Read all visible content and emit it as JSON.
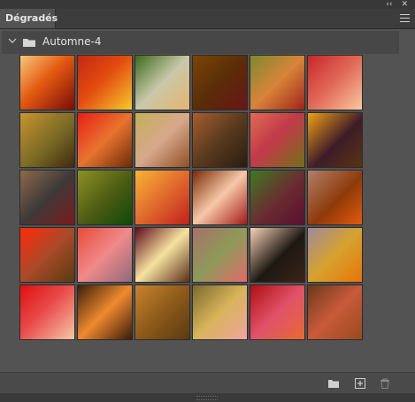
{
  "panel": {
    "tab_title": "Dégradés",
    "collapse_glyph": "‹‹",
    "close_glyph": "✕"
  },
  "group": {
    "name": "Automne-4",
    "expanded": true
  },
  "icons": {
    "chevron": "chevron-down-icon",
    "folder": "folder-icon",
    "new_group": "folder-icon",
    "new_gradient": "add-icon",
    "delete": "trash-icon",
    "menu": "panel-menu-icon"
  },
  "swatches": [
    "linear-gradient(135deg,#f5c87a 0%,#e45a12 45%,#7a0c06 100%)",
    "linear-gradient(135deg,#c22a12 0%,#e24a10 45%,#f7c92e 100%)",
    "linear-gradient(135deg,#3d6a1e 0%,#c9c8a8 50%,#e5b46e 100%)",
    "linear-gradient(135deg,#7a4606 0%,#5a2d08 50%,#6a1416 100%)",
    "linear-gradient(135deg,#7d8a2e 0%,#d8843a 50%,#a02418 100%)",
    "linear-gradient(135deg,#c8262a 0%,#e26a58 50%,#f8c9a0 100%)",
    "linear-gradient(135deg,#c8942e 0%,#7a6a26 55%,#3e2a0c 100%)",
    "linear-gradient(135deg,#e81e16 0%,#e8742e 50%,#6e2a08 100%)",
    "linear-gradient(135deg,#c2b058 0%,#d8a88c 50%,#8e5022 100%)",
    "linear-gradient(135deg,#a65e30 0%,#5a3a1e 50%,#2a1c10 100%)",
    "linear-gradient(135deg,#e26a52 0%,#c23a4a 45%,#747018 100%)",
    "linear-gradient(135deg,#f0a016 0%,#3e1c28 55%,#5a3412 100%)",
    "linear-gradient(135deg,#8e6a4a 0%,#3e3a3a 50%,#7a1c1a 100%)",
    "linear-gradient(135deg,#8e9026 0%,#4a5a12 55%,#0e4a08 100%)",
    "linear-gradient(135deg,#f8b436 0%,#e06a2e 50%,#c2201a 100%)",
    "linear-gradient(135deg,#7a2a06 0%,#f6c8a8 50%,#a21a1a 100%)",
    "linear-gradient(135deg,#3e7a22 0%,#6a2a30 55%,#5a1030 100%)",
    "linear-gradient(135deg,#b0806a 0%,#8e3a0a 55%,#e45a0c 100%)",
    "linear-gradient(135deg,#ff2a0a 0%,#a84a2a 50%,#5a3a10 100%)",
    "linear-gradient(135deg,#e84a38 0%,#f08a8a 50%,#8e6a7a 100%)",
    "linear-gradient(135deg,#5e0c1a 0%,#f6e2a0 50%,#5a2e1a 100%)",
    "linear-gradient(135deg,#a8706a 0%,#8e9a5a 50%,#e26a6a 100%)",
    "linear-gradient(135deg,#f6d2b8 0%,#1e1812 55%,#3a2418 100%)",
    "linear-gradient(135deg,#9e8a9a 0%,#d6a22e 50%,#e8740a 100%)",
    "linear-gradient(135deg,#e00e0e 0%,#e84a4a 45%,#f6c8a8 100%)",
    "linear-gradient(135deg,#3a200a 0%,#f08a2e 50%,#3a1c08 100%)",
    "linear-gradient(135deg,#c8842e 0%,#8e5a1a 50%,#5a3a10 100%)",
    "linear-gradient(135deg,#7a6a2e 0%,#d8b45a 50%,#f0a4a0 100%)",
    "linear-gradient(135deg,#b00e10 0%,#e0526a 50%,#e86a2e 100%)",
    "linear-gradient(135deg,#6a3a1a 0%,#c85a3a 50%,#9a4a20 100%)"
  ]
}
